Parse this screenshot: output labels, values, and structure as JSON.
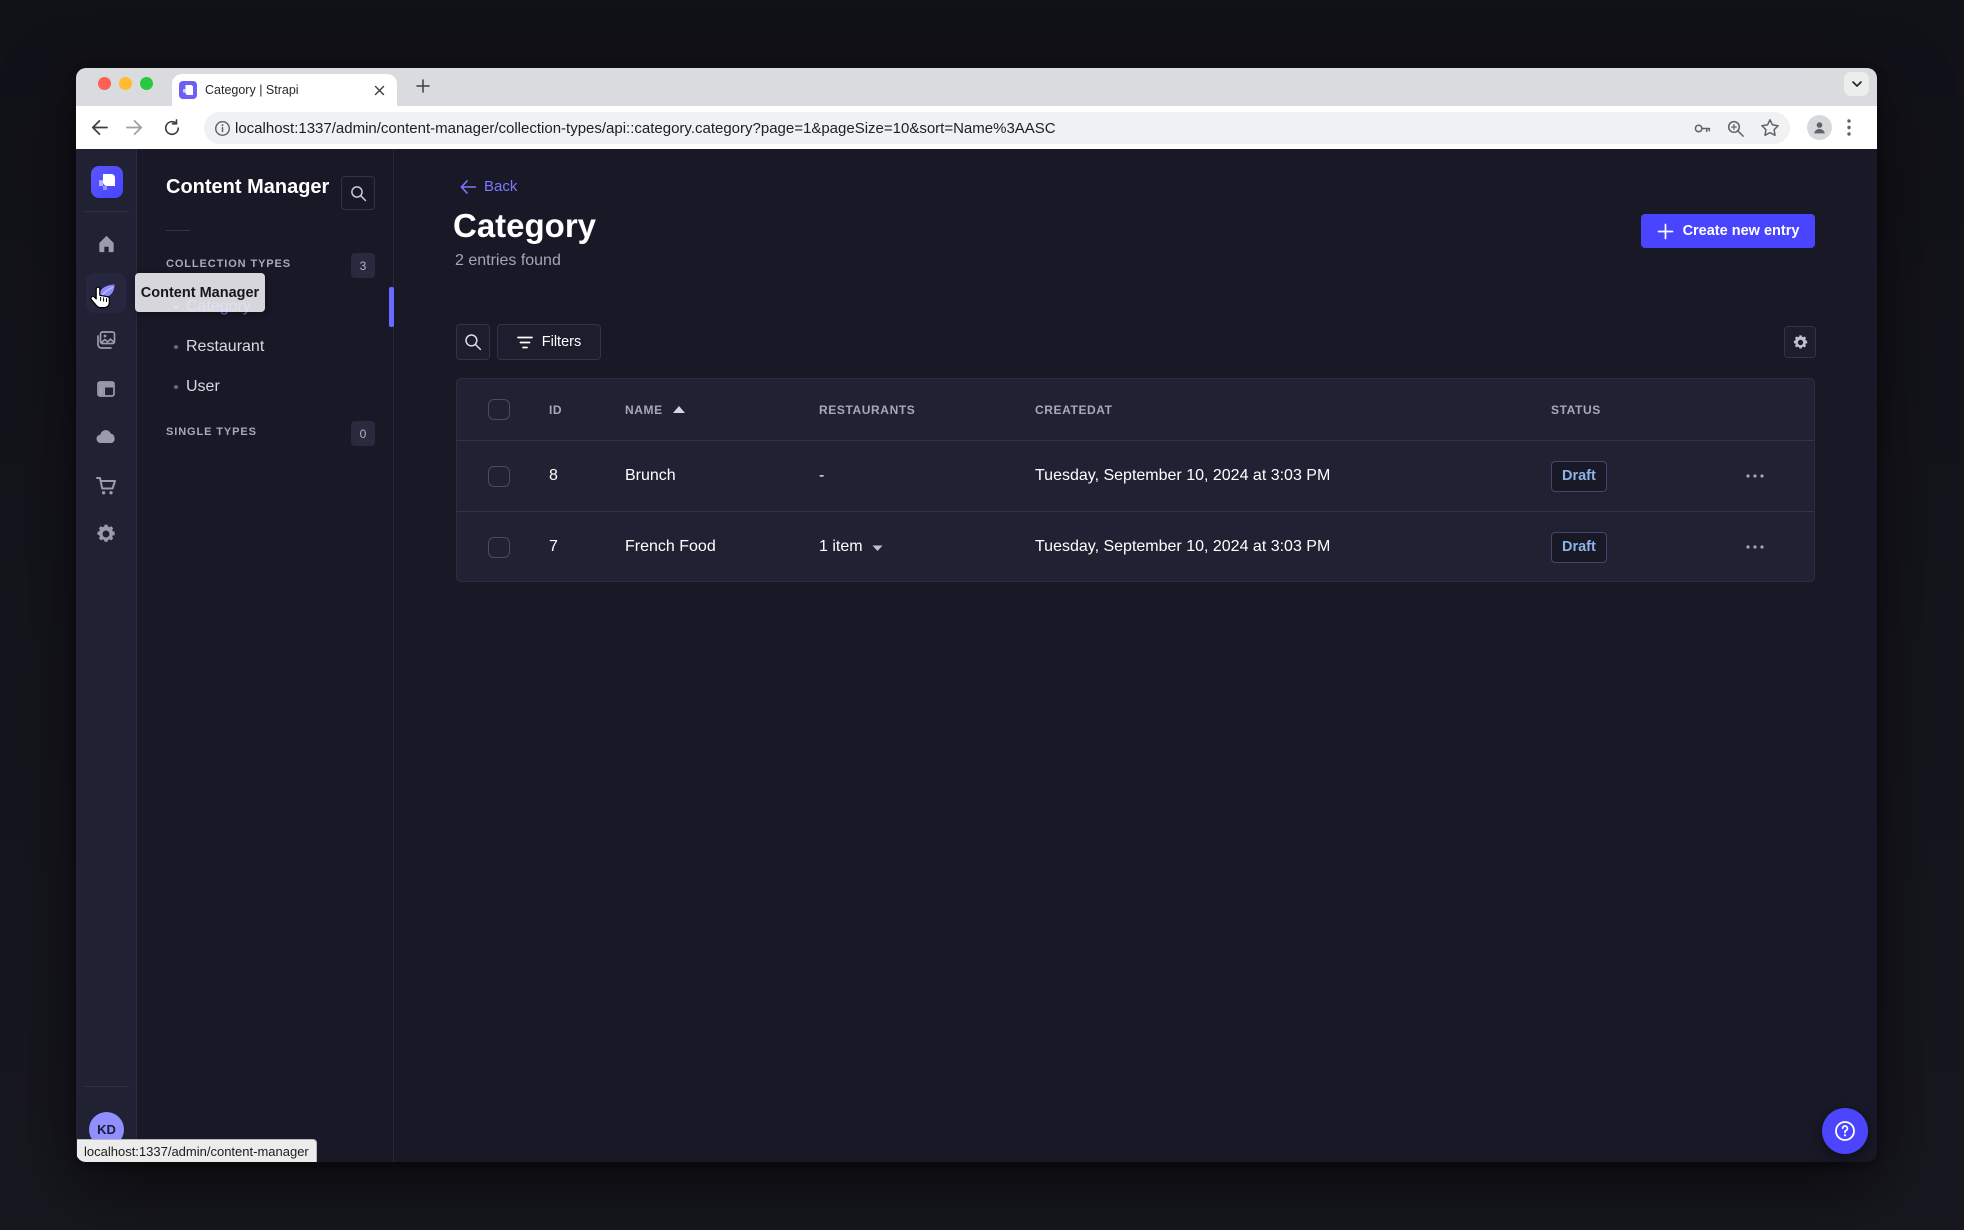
{
  "browser": {
    "tab_title": "Category | Strapi",
    "url": "localhost:1337/admin/content-manager/collection-types/api::category.category?page=1&pageSize=10&sort=Name%3AASC",
    "status_bar_url": "localhost:1337/admin/content-manager"
  },
  "rail": {
    "tooltip": "Content Manager",
    "avatar_initials": "KD",
    "items": [
      "home",
      "content-manager",
      "media-library",
      "content-type-builder",
      "deploy-cloud",
      "marketplace",
      "settings"
    ]
  },
  "subnav": {
    "title": "Content Manager",
    "collection_section": {
      "label": "COLLECTION TYPES",
      "count": "3",
      "items": [
        {
          "label": "Category",
          "active": true
        },
        {
          "label": "Restaurant",
          "active": false
        },
        {
          "label": "User",
          "active": false
        }
      ]
    },
    "single_section": {
      "label": "SINGLE TYPES",
      "count": "0"
    }
  },
  "main": {
    "back_label": "Back",
    "title": "Category",
    "subtitle": "2 entries found",
    "create_button_label": "Create new entry",
    "filters_button_label": "Filters",
    "table": {
      "columns": [
        "ID",
        "NAME",
        "RESTAURANTS",
        "CREATEDAT",
        "STATUS"
      ],
      "rows": [
        {
          "id": "8",
          "name": "Brunch",
          "restaurants": "-",
          "createdAt": "Tuesday, September 10, 2024 at 3:03 PM",
          "status": "Draft"
        },
        {
          "id": "7",
          "name": "French Food",
          "restaurants": "1 item",
          "createdAt": "Tuesday, September 10, 2024 at 3:03 PM",
          "status": "Draft"
        }
      ]
    }
  },
  "colors": {
    "primary": "#4945ff",
    "primary_light": "#7b79ff",
    "page_bg": "#181826",
    "surface": "#212134",
    "muted_text": "#a5a5ba",
    "draft_text": "#8ab4e8"
  }
}
